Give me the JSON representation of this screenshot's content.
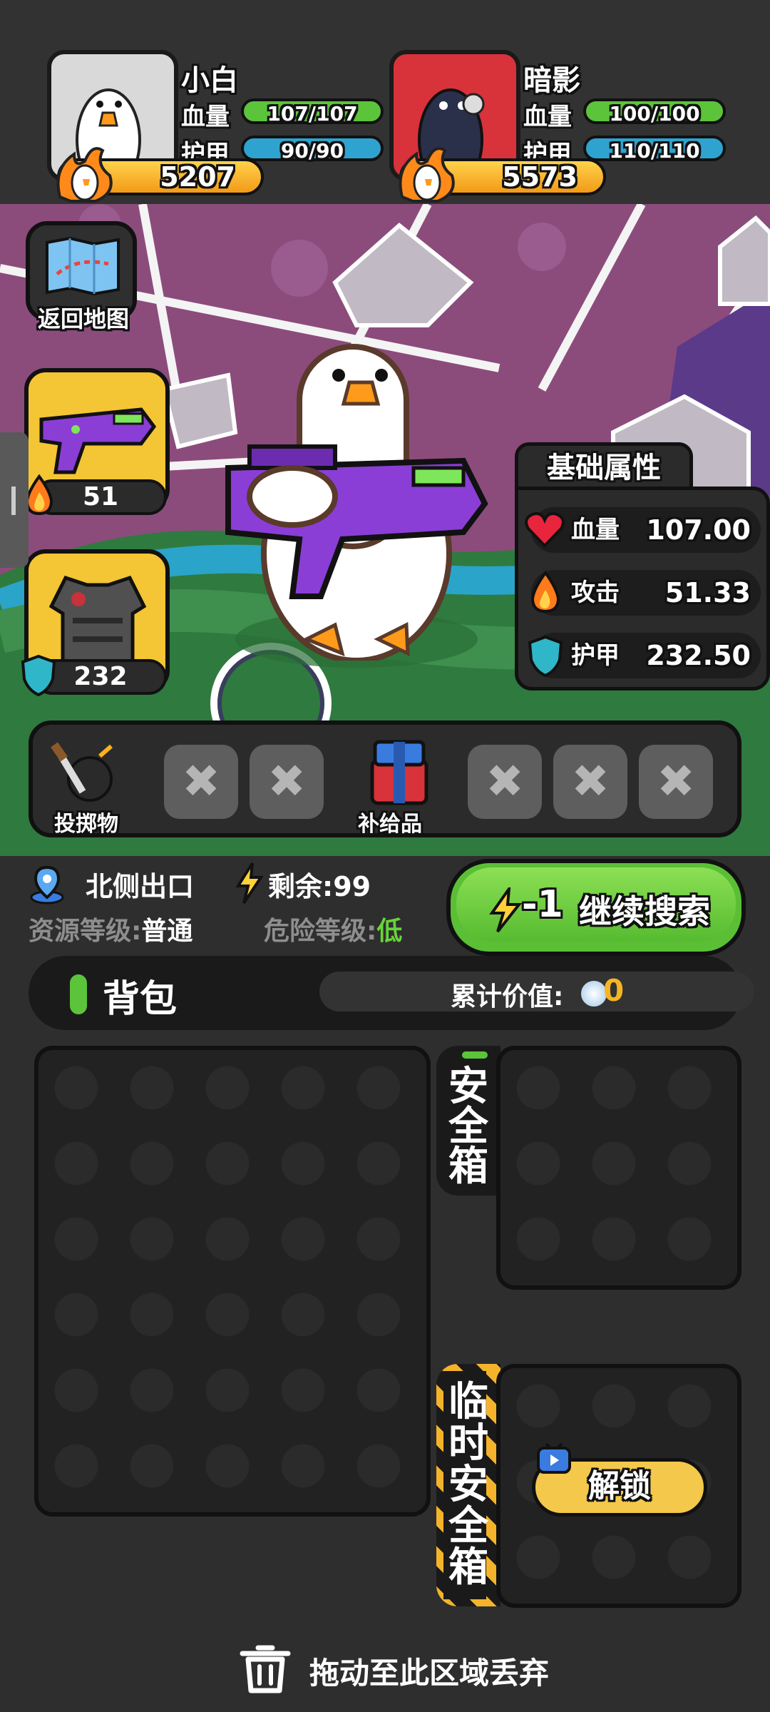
{
  "players": [
    {
      "name": "小白",
      "hp_label": "血量",
      "hp": "107/107",
      "armor_label": "护甲",
      "armor": "90/90",
      "power": "5207"
    },
    {
      "name": "暗影",
      "hp_label": "血量",
      "hp": "100/100",
      "armor_label": "护甲",
      "armor": "110/110",
      "power": "5573"
    }
  ],
  "map": {
    "back_label": "返回地图",
    "weapon_count": "51",
    "armor_count": "232",
    "attrs": {
      "title": "基础属性",
      "rows": [
        {
          "name": "血量",
          "value": "107.00"
        },
        {
          "name": "攻击",
          "value": "51.33"
        },
        {
          "name": "护甲",
          "value": "232.50"
        }
      ]
    },
    "items": {
      "throwable_label": "投掷物",
      "supply_label": "补给品",
      "empty_glyph": "✖"
    }
  },
  "status": {
    "location": "北侧出口",
    "remaining": "剩余:99",
    "resource_prefix": "资源等级:",
    "resource_level": "普通",
    "danger_prefix": "危险等级:",
    "danger_level": "低"
  },
  "continue": {
    "cost": "-1",
    "label": "继续搜索"
  },
  "bag": {
    "title": "背包",
    "value_label": "累计价值:",
    "value": "0"
  },
  "safe_box": {
    "label_1": "安",
    "label_2": "全",
    "label_3": "箱"
  },
  "temp_box": {
    "label_1": "临",
    "label_2": "时",
    "label_3": "安",
    "label_4": "全",
    "label_5": "箱",
    "unlock_label": "解锁"
  },
  "discard": {
    "label": "拖动至此区域丢弃"
  },
  "colors": {
    "hp": "#5cc43a",
    "armor": "#2fa3d0",
    "continue": "#5bbf36",
    "coin_value": "#f5b623",
    "danger_low": "#68d43a"
  }
}
